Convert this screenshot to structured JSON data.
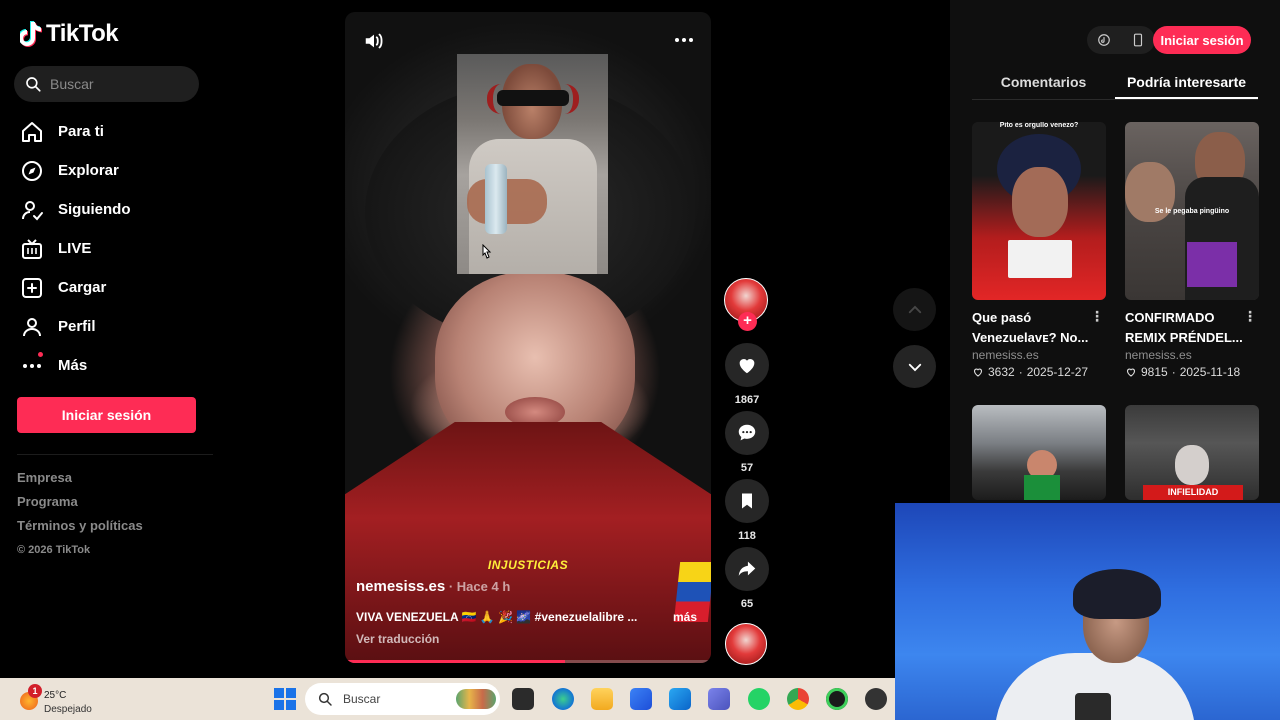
{
  "brand": {
    "name": "TikTok"
  },
  "search": {
    "placeholder": "Buscar"
  },
  "nav": [
    {
      "label": "Para ti",
      "icon": "home-icon"
    },
    {
      "label": "Explorar",
      "icon": "compass-icon"
    },
    {
      "label": "Siguiendo",
      "icon": "following-icon"
    },
    {
      "label": "LIVE",
      "icon": "live-tv-icon"
    },
    {
      "label": "Cargar",
      "icon": "upload-icon"
    },
    {
      "label": "Perfil",
      "icon": "profile-icon"
    },
    {
      "label": "Más",
      "icon": "more-dots-icon"
    }
  ],
  "sidebar": {
    "login_label": "Iniciar sesión",
    "footer": {
      "link1": "Empresa",
      "link2": "Programa",
      "link3": "Términos y políticas",
      "copyright": "© 2026 TikTok"
    }
  },
  "video": {
    "caption_word": "INJUSTICIAS",
    "author": "nemesiss.es",
    "time": " · Hace 4 h",
    "description": "VIVA VENEZUELA 🇻🇪 🙏 🎉 🌌 #venezuelalibre ...",
    "more_label": "más",
    "translate_label": "Ver traducción",
    "progress": 0.6
  },
  "actions": {
    "likes": "1867",
    "comments": "57",
    "saves": "118",
    "shares": "65"
  },
  "right_panel": {
    "login_label": "Iniciar sesión",
    "tabs": [
      "Comentarios",
      "Podría interesarte"
    ],
    "active_tab": 1,
    "cards": [
      {
        "title": "Que pasó Venezuelaᴠᴇ? No...",
        "author": "nemesiss.es",
        "likes": "3632",
        "date": "2025-12-27",
        "thumb_text": "Pito es orgullo venezo?"
      },
      {
        "title": "CONFIRMADO REMIX PRÉNDEL...",
        "author": "nemesiss.es",
        "likes": "9815",
        "date": "2025-11-18",
        "thumb_text": "Se le pegaba pingüino"
      },
      {
        "title": "",
        "author": "",
        "likes": "",
        "date": "",
        "thumb_text": ""
      },
      {
        "title": "",
        "author": "",
        "likes": "",
        "date": "",
        "thumb_text": "INFIELIDAD"
      }
    ]
  },
  "taskbar": {
    "weather_temp": "25°C",
    "weather_desc": "Despejado",
    "weather_badge": "1",
    "search_placeholder": "Buscar"
  },
  "colors": {
    "accent": "#fe2c55",
    "background": "#000000",
    "panel": "#0f0f0f"
  }
}
